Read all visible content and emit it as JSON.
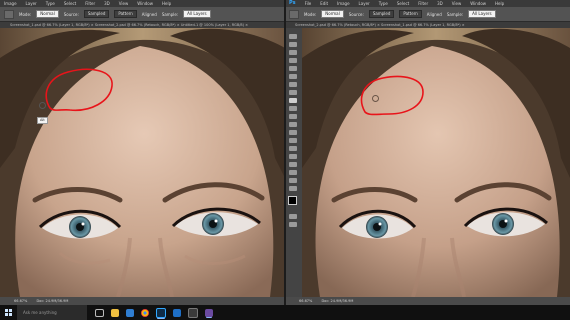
{
  "left_window": {
    "menu": [
      "Image",
      "Layer",
      "Type",
      "Select",
      "Filter",
      "3D",
      "View",
      "Window",
      "Help"
    ],
    "options": {
      "mode_label": "Mode:",
      "mode_value": "Normal",
      "source_label": "Source:",
      "sampled": "Sampled",
      "pattern": "Pattern",
      "aligned_label": "Aligned",
      "sample_label": "Sample:",
      "sample_value": "All Layers"
    },
    "doc_tab": "Screenshot_1.psd @ 66.7% (Layer 1, RGB/8*) × Screenshot_2.psd @ 66.7% (Retouch, RGB/8*) × Untitled-1 @ 100% (Layer 1, RGB/8) ×",
    "tooltip": "Alt",
    "status_zoom": "66.67%",
    "status_doc": "Doc: 24.9M/36.9M"
  },
  "right_window": {
    "menu": [
      "Ps",
      "File",
      "Edit",
      "Image",
      "Layer",
      "Type",
      "Select",
      "Filter",
      "3D",
      "View",
      "Window",
      "Help"
    ],
    "options": {
      "mode_label": "Mode:",
      "mode_value": "Normal",
      "source_label": "Source:",
      "sampled": "Sampled",
      "pattern": "Pattern",
      "aligned_label": "Aligned",
      "sample_label": "Sample:",
      "sample_value": "All Layers"
    },
    "doc_tab": "Screenshot_2.psd @ 66.7% (Retouch, RGB/8*) × Screenshot_1.psd @ 66.7% (Layer 1, RGB/8*) ×",
    "status_zoom": "66.67%",
    "status_doc": "Doc: 24.9M/36.9M"
  },
  "taskbar": {
    "search_placeholder": "Ask me anything",
    "apps": [
      "task-view",
      "file-explorer",
      "edge",
      "chrome",
      "photoshop",
      "mail",
      "store",
      "settings"
    ]
  },
  "colors": {
    "menu_bg": "#3a3a3a",
    "options_bg": "#535353",
    "taskbar_bg": "#101010",
    "annotation": "#e8141a",
    "ps_blue": "#31a8ff"
  }
}
